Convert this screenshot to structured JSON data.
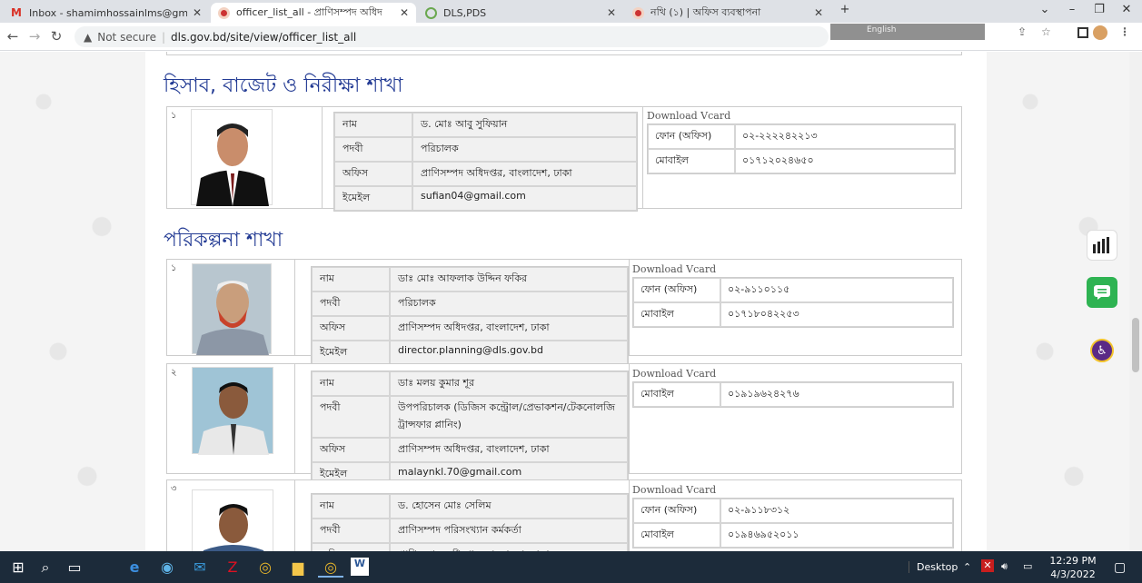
{
  "browser": {
    "tabs": [
      {
        "title": "Inbox - shamimhossainlms@gma",
        "active": false
      },
      {
        "title": "officer_list_all - প্রাণিসম্পদ অধিদ",
        "active": true
      },
      {
        "title": "DLS,PDS",
        "active": false
      },
      {
        "title": "নথি (১) | অফিস ব্যবস্থাপনা",
        "active": false
      }
    ],
    "new_tab": "+",
    "security_label": "Not secure",
    "url": "dls.gov.bd/site/view/officer_list_all",
    "ext_lang": "English"
  },
  "sections": [
    {
      "title": "হিসাব, বাজেট ও নিরীক্ষা শাখা",
      "officers": [
        {
          "serial": "১",
          "rows": [
            {
              "key": "নাম",
              "value": "ড. মোঃ আবু সুফিয়ান"
            },
            {
              "key": "পদবী",
              "value": "পরিচালক"
            },
            {
              "key": "অফিস",
              "value": "প্রাণিসম্পদ অধিদপ্তর, বাংলাদেশ, ঢাকা"
            },
            {
              "key": "ইমেইল",
              "value": "sufian04@gmail.com"
            }
          ],
          "vcard_label": "Download Vcard",
          "phones": [
            {
              "key": "ফোন (অফিস)",
              "value": "০২-২২২২৪২২১৩"
            },
            {
              "key": "মোবাইল",
              "value": "০১৭১২০২৪৬৫০"
            }
          ]
        }
      ]
    },
    {
      "title": "পরিকল্পনা শাখা",
      "officers": [
        {
          "serial": "১",
          "rows": [
            {
              "key": "নাম",
              "value": "ডাঃ মোঃ আফলাক উদ্দিন ফকির"
            },
            {
              "key": "পদবী",
              "value": "পরিচালক"
            },
            {
              "key": "অফিস",
              "value": "প্রাণিসম্পদ অধিদপ্তর, বাংলাদেশ, ঢাকা"
            },
            {
              "key": "ইমেইল",
              "value": "director.planning@dls.gov.bd"
            }
          ],
          "vcard_label": "Download Vcard",
          "phones": [
            {
              "key": "ফোন (অফিস)",
              "value": "০২-৯১১০১১৫"
            },
            {
              "key": "মোবাইল",
              "value": "০১৭১৮০৪২২৫৩"
            }
          ]
        },
        {
          "serial": "২",
          "rows": [
            {
              "key": "নাম",
              "value": "ডাঃ মলয় কুমার শূর"
            },
            {
              "key": "পদবী",
              "value": "উপপরিচালক (ডিজিস কন্ট্রোল/প্রেভাকশন/টেকনোলজি ট্রান্সফার প্লানিং)"
            },
            {
              "key": "অফিস",
              "value": "প্রাণিসম্পদ অধিদপ্তর, বাংলাদেশ, ঢাকা"
            },
            {
              "key": "ইমেইল",
              "value": "malaynkl.70@gmail.com"
            }
          ],
          "vcard_label": "Download Vcard",
          "phones": [
            {
              "key": "মোবাইল",
              "value": "০১৯১৯৬২৪২৭৬"
            }
          ]
        },
        {
          "serial": "৩",
          "rows": [
            {
              "key": "নাম",
              "value": "ড. হোসেন মোঃ সেলিম"
            },
            {
              "key": "পদবী",
              "value": "প্রাণিসম্পদ পরিসংখ্যান কর্মকর্তা"
            },
            {
              "key": "অফিস",
              "value": "প্রাণিসম্পদ অধিদপ্তর, বাংলাদেশ, ঢাকা"
            }
          ],
          "vcard_label": "Download Vcard",
          "phones": [
            {
              "key": "ফোন (অফিস)",
              "value": "০২-৯১১৮৩১২"
            },
            {
              "key": "মোবাইল",
              "value": "০১৯৪৬৯৫২০১১"
            }
          ]
        }
      ]
    }
  ],
  "taskbar": {
    "desktop_label": "Desktop",
    "time": "12:29 PM",
    "date": "4/3/2022"
  },
  "colors": {
    "section_title": "#233b94",
    "taskbar": "#1c2b3a",
    "chat_widget": "#2eb352",
    "access_widget": "#5b2a86"
  }
}
